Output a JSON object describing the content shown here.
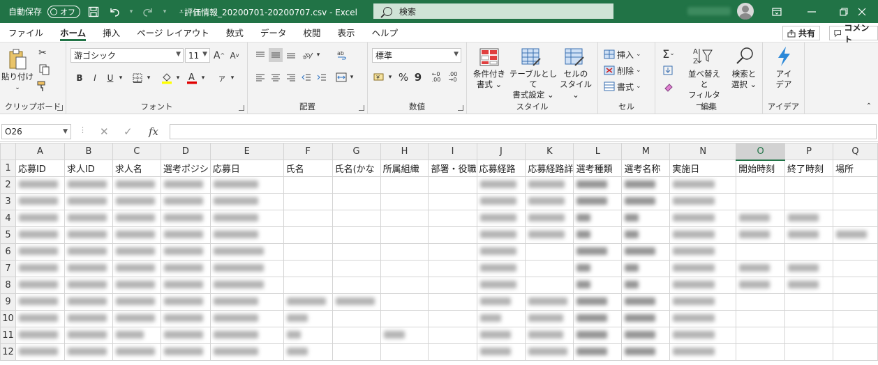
{
  "titlebar": {
    "autosave_label": "自動保存",
    "autosave_state": "オフ",
    "doc_title": "評価情報_20200701-20200707.csv  -  Excel",
    "search_placeholder": "検索",
    "icons": [
      "save-icon",
      "undo-icon",
      "redo-icon",
      "customize-qat-icon",
      "ribbon-display-icon",
      "minimize-icon",
      "restore-icon",
      "close-icon"
    ]
  },
  "tabs": [
    "ファイル",
    "ホーム",
    "挿入",
    "ページ レイアウト",
    "数式",
    "データ",
    "校閲",
    "表示",
    "ヘルプ"
  ],
  "active_tab": "ホーム",
  "share_label": "共有",
  "comment_label": "コメント",
  "ribbon": {
    "clipboard": {
      "paste_label": "貼り付け",
      "group_label": "クリップボード"
    },
    "font": {
      "font_name": "游ゴシック",
      "font_size": "11",
      "bold": "B",
      "italic": "I",
      "underline": "U",
      "group_label": "フォント"
    },
    "alignment": {
      "group_label": "配置"
    },
    "number": {
      "format": "標準",
      "percent": "%",
      "comma": "9",
      "group_label": "数値"
    },
    "styles": {
      "conditional_l1": "条件付き",
      "conditional_l2": "書式",
      "table_l1": "テーブルとして",
      "table_l2": "書式設定",
      "cell_l1": "セルの",
      "cell_l2": "スタイル",
      "group_label": "スタイル"
    },
    "cells": {
      "insert": "挿入",
      "delete": "削除",
      "format": "書式",
      "group_label": "セル"
    },
    "editing": {
      "sort_l1": "並べ替えと",
      "sort_l2": "フィルター",
      "find_l1": "検索と",
      "find_l2": "選択",
      "group_label": "編集"
    },
    "ideas": {
      "l1": "アイ",
      "l2": "デア",
      "group_label": "アイデア"
    }
  },
  "formula_bar": {
    "name_box": "O26",
    "cancel": "✕",
    "enter": "✓",
    "fx": "fx",
    "value": ""
  },
  "sheet": {
    "columns": [
      "A",
      "B",
      "C",
      "D",
      "E",
      "F",
      "G",
      "H",
      "I",
      "J",
      "K",
      "L",
      "M",
      "N",
      "O",
      "P",
      "Q"
    ],
    "active_column": "O",
    "header_row": [
      "応募ID",
      "求人ID",
      "求人名",
      "選考ポジシ",
      "応募日",
      "氏名",
      "氏名(かな",
      "所属組織",
      "部署・役職",
      "応募経路",
      "応募経路詳",
      "選考種類",
      "選考名称",
      "実施日",
      "開始時刻",
      "終了時刻",
      "場所"
    ],
    "row_numbers": [
      "1",
      "2",
      "3",
      "4",
      "5",
      "6",
      "7",
      "8",
      "9",
      "10",
      "11",
      "12"
    ]
  }
}
